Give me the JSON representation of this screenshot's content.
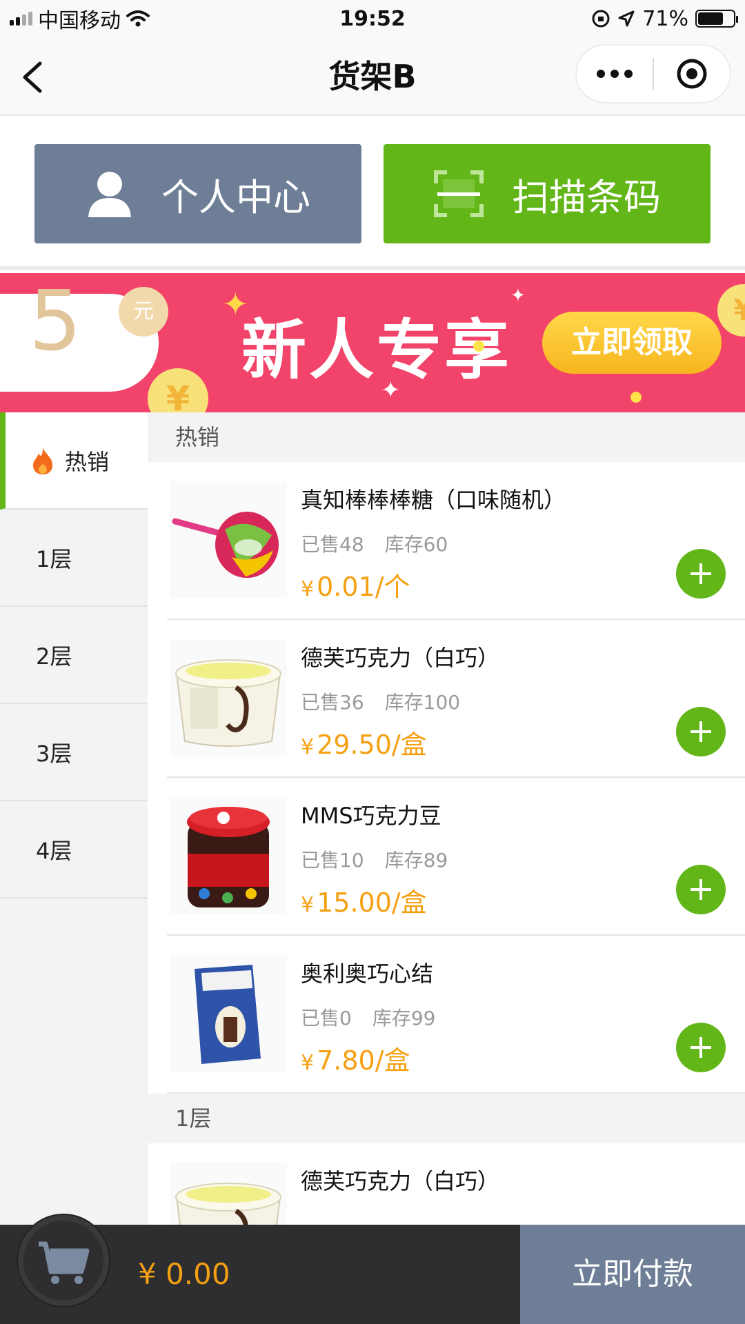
{
  "status_bar": {
    "carrier": "中国移动",
    "time": "19:52",
    "battery": "71%",
    "battery_level": 0.71
  },
  "nav": {
    "title": "货架B",
    "back_icon": "chevron-left-icon",
    "more_icon": "more-dots-icon",
    "close_icon": "target-circle-icon"
  },
  "actions": {
    "user_center_label": "个人中心",
    "user_center_icon": "user-icon",
    "user_center_color": "#6e7e96",
    "scan_label": "扫描条码",
    "scan_icon": "scan-icon",
    "scan_color": "#62b617"
  },
  "banner": {
    "coupon_amount": "5",
    "coupon_unit": "元",
    "title": "新人专享",
    "claim_label": "立即领取",
    "coin_symbol": "¥",
    "background_color": "#f2436a"
  },
  "sidebar": {
    "items": [
      {
        "label": "热销",
        "icon": "fire-icon",
        "active": true
      },
      {
        "label": "1层",
        "active": false
      },
      {
        "label": "2层",
        "active": false
      },
      {
        "label": "3层",
        "active": false
      },
      {
        "label": "4层",
        "active": false
      }
    ]
  },
  "content": {
    "sections": [
      {
        "title": "热销",
        "products": [
          {
            "name": "真知棒棒棒糖（口味随机）",
            "sold": "已售48",
            "stock": "库存60",
            "price": "0.01/个",
            "thumb": "lollipop-image"
          },
          {
            "name": "德芙巧克力（白巧）",
            "sold": "已售36",
            "stock": "库存100",
            "price": "29.50/盒",
            "thumb": "dove-chocolate-image"
          },
          {
            "name": "MMS巧克力豆",
            "sold": "已售10",
            "stock": "库存89",
            "price": "15.00/盒",
            "thumb": "mms-jar-image"
          },
          {
            "name": "奥利奥巧心结",
            "sold": "已售0",
            "stock": "库存99",
            "price": "7.80/盒",
            "thumb": "oreo-box-image"
          }
        ]
      },
      {
        "title": "1层",
        "products": [
          {
            "name": "德芙巧克力（白巧）",
            "thumb": "dove-chocolate-image"
          }
        ]
      }
    ],
    "currency": "¥",
    "price_color": "#f5a012"
  },
  "bottom_bar": {
    "cart_icon": "cart-icon",
    "total": "¥ 0.00",
    "pay_label": "立即付款"
  }
}
